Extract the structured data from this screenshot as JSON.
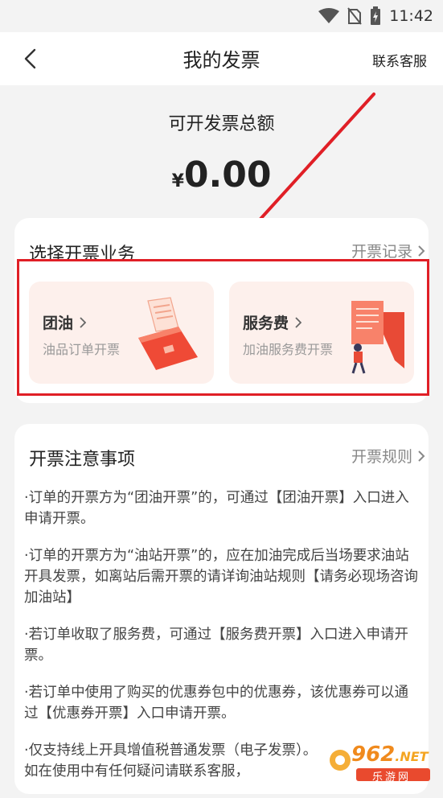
{
  "status_bar": {
    "time": "11:42",
    "icons": [
      "wifi-icon",
      "no-sim-icon",
      "battery-charging-icon"
    ]
  },
  "nav": {
    "back_icon": "chevron-left-icon",
    "title": "我的发票",
    "right_link": "联系客服"
  },
  "summary": {
    "label": "可开发票总额",
    "currency": "¥",
    "amount": "0.00"
  },
  "business": {
    "title": "选择开票业务",
    "history_link": "开票记录",
    "items": [
      {
        "title": "团油",
        "subtitle": "油品订单开票",
        "illustration": "fuel-receipt-icon"
      },
      {
        "title": "服务费",
        "subtitle": "加油服务费开票",
        "illustration": "service-fee-document-icon"
      }
    ]
  },
  "notice": {
    "title": "开票注意事项",
    "rules_link": "开票规则",
    "items": [
      "·订单的开票方为“团油开票”的，可通过【团油开票】入口进入申请开票。",
      "·订单的开票方为“油站开票”的，应在加油完成后当场要求油站开具发票，如离站后需开票的请详询油站规则【请务必现场咨询加油站】",
      "·若订单收取了服务费，可通过【服务费开票】入口进入申请开票。",
      "·若订单中使用了购买的优惠券包中的优惠券，该优惠券可以通过【优惠券开票】入口申请开票。",
      "·仅支持线上开具增值税普通发票（电子发票）。\n如在使用中有任何疑问请联系客服，"
    ]
  },
  "watermark": {
    "brand": "962",
    "suffix": ".NET",
    "subtitle": "乐游网"
  },
  "colors": {
    "accent_red": "#e01f26",
    "tile_bg": "#fdf0ec",
    "page_bg": "#f3f3f3"
  }
}
